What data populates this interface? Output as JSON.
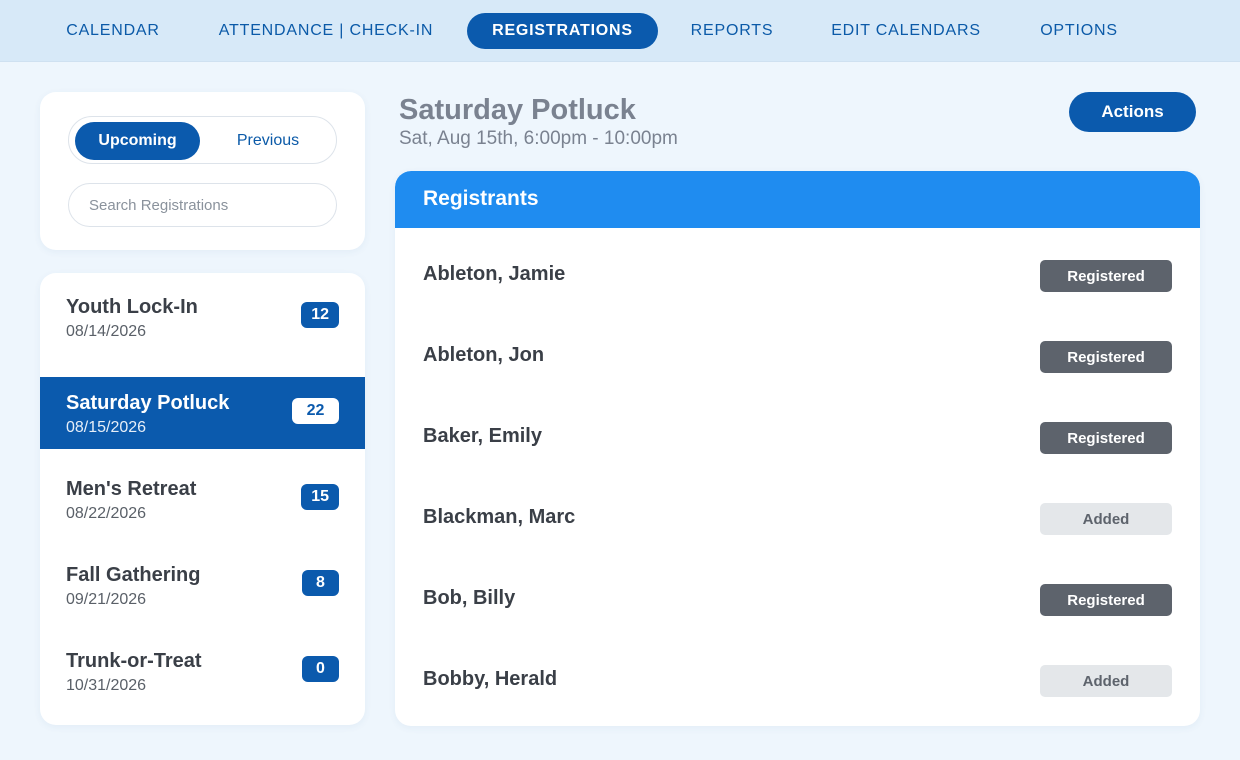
{
  "nav": {
    "items": [
      {
        "label": "CALENDAR",
        "active": false
      },
      {
        "label": "ATTENDANCE | CHECK-IN",
        "active": false
      },
      {
        "label": "REGISTRATIONS",
        "active": true
      },
      {
        "label": "REPORTS",
        "active": false
      },
      {
        "label": "EDIT CALENDARS",
        "active": false
      },
      {
        "label": "OPTIONS",
        "active": false
      }
    ]
  },
  "filter": {
    "upcoming_label": "Upcoming",
    "previous_label": "Previous",
    "selected": "Upcoming",
    "search_placeholder": "Search Registrations",
    "search_value": ""
  },
  "events": [
    {
      "name": "Youth Lock-In",
      "date": "08/14/2026",
      "count": "12",
      "selected": false
    },
    {
      "name": "Saturday Potluck",
      "date": "08/15/2026",
      "count": "22",
      "selected": true
    },
    {
      "name": "Men's Retreat",
      "date": "08/22/2026",
      "count": "15",
      "selected": false
    },
    {
      "name": "Fall Gathering",
      "date": "09/21/2026",
      "count": "8",
      "selected": false
    },
    {
      "name": "Trunk-or-Treat",
      "date": "10/31/2026",
      "count": "0",
      "selected": false
    }
  ],
  "detail": {
    "title": "Saturday Potluck",
    "when": "Sat, Aug 15th, 6:00pm - 10:00pm",
    "actions_label": "Actions",
    "panel_title": "Registrants",
    "registrants": [
      {
        "name": "Ableton, Jamie",
        "status": "Registered"
      },
      {
        "name": "Ableton, Jon",
        "status": "Registered"
      },
      {
        "name": "Baker, Emily",
        "status": "Registered"
      },
      {
        "name": "Blackman, Marc",
        "status": "Added"
      },
      {
        "name": "Bob, Billy",
        "status": "Registered"
      },
      {
        "name": "Bobby, Herald",
        "status": "Added"
      }
    ]
  },
  "colors": {
    "accent": "#0b5aad",
    "panel_header": "#1f8cf0",
    "nav_background": "#d7e9f8",
    "page_background": "#eef6fd",
    "status_registered": "#5d636c",
    "status_added": "#e4e7ea"
  }
}
